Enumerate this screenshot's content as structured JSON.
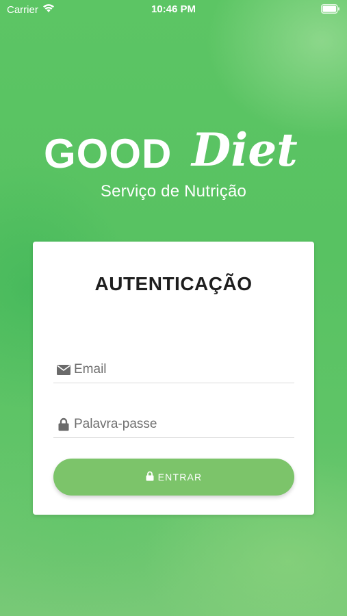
{
  "status_bar": {
    "carrier": "Carrier",
    "time": "10:46 PM",
    "wifi_icon": "wifi-icon",
    "battery_icon": "battery-icon"
  },
  "brand": {
    "word_bold": "GOOD",
    "word_script": "Diet",
    "subtitle": "Serviço de Nutrição",
    "text_color": "#ffffff"
  },
  "login_card": {
    "title": "AUTENTICAÇÃO",
    "email": {
      "placeholder": "Email",
      "value": "",
      "icon": "envelope-icon"
    },
    "password": {
      "placeholder": "Palavra-passe",
      "value": "",
      "icon": "lock-icon"
    },
    "submit": {
      "label": "ENTRAR",
      "icon": "lock-icon",
      "color": "#7cc46a"
    }
  },
  "colors": {
    "background": "#5cc564",
    "card": "#ffffff",
    "title": "#1e1e1e"
  }
}
